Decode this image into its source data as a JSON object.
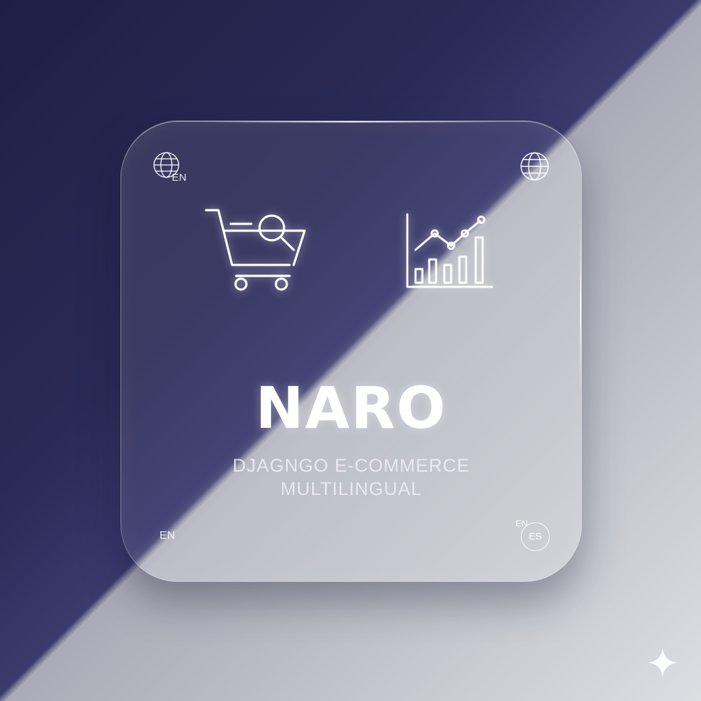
{
  "brand": {
    "name": "NARO",
    "tagline_line1": "DJAGNGO E-COMMERCE",
    "tagline_line2": "MULTILINGUAL"
  },
  "corners": {
    "top_left_code": "EN",
    "bottom_left_code": "EN",
    "bottom_right_code_top": "EN",
    "bottom_right_code_badge": "ES"
  },
  "icons": {
    "top_left": "globe-icon",
    "top_right": "globe-icon",
    "feature_left": "shopping-cart-search-icon",
    "feature_right": "bar-line-chart-icon",
    "watermark": "sparkle-icon"
  },
  "colors": {
    "background_dark": "#2a2a56",
    "background_light": "#c3c5cc",
    "foreground": "#ffffff"
  }
}
